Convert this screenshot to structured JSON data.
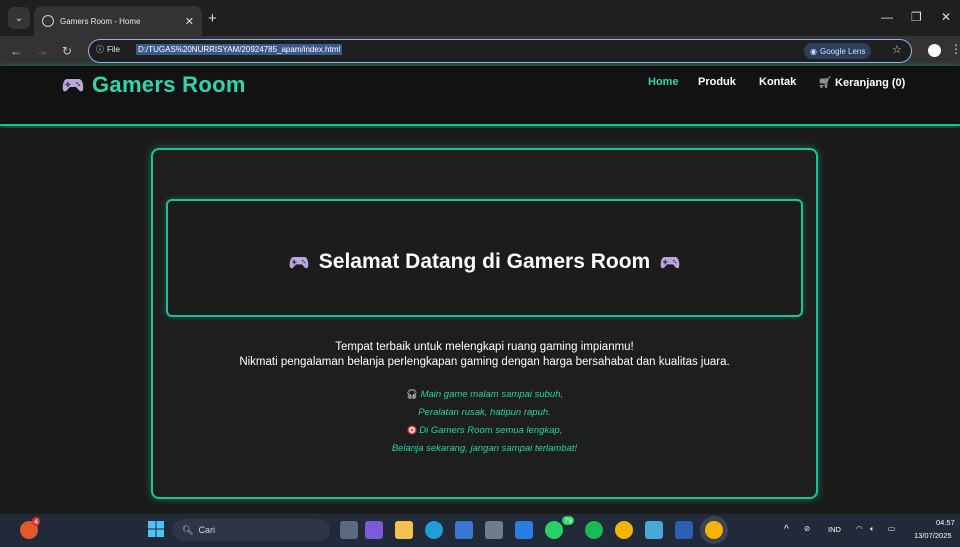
{
  "browser": {
    "tab_title": "Gamers Room - Home",
    "tab_close": "✕",
    "new_tab": "+",
    "site_info_label": "File",
    "url": "D:/TUGAS%20NURRISYAM/20924785_apam/index.html",
    "lens_label": "Google Lens",
    "window_minimize": "—",
    "window_restore": "❐",
    "window_close": "✕"
  },
  "site": {
    "brand": "Gamers Room",
    "nav": {
      "home": "Home",
      "produk": "Produk",
      "kontak": "Kontak",
      "keranjang": "Keranjang (0)"
    },
    "hero_title": "Selamat Datang di Gamers Room",
    "desc_line1": "Tempat terbaik untuk melengkapi ruang gaming impianmu!",
    "desc_line2": "Nikmati pengalaman belanja perlengkapan gaming dengan harga bersahabat dan kualitas juara.",
    "quote_line1": "Main game malam sampai subuh,",
    "quote_line2": "Peralatan rusak, hatipun rapuh.",
    "quote_line3": "Di Gamers Room semua lengkap,",
    "quote_line4": "Belanja sekarang, jangan sampai terlambat!",
    "accent_color": "#19c398"
  },
  "taskbar": {
    "search_placeholder": "Cari",
    "whatsapp_badge": "79",
    "notif_badge": "4",
    "language": "IND",
    "time": "04.57",
    "date": "13/07/2025"
  },
  "icons": [
    "gamepad-icon",
    "cart-icon",
    "headphones-icon",
    "target-icon",
    "windows-icon",
    "search-icon",
    "wifi-icon",
    "speaker-icon",
    "battery-icon"
  ]
}
